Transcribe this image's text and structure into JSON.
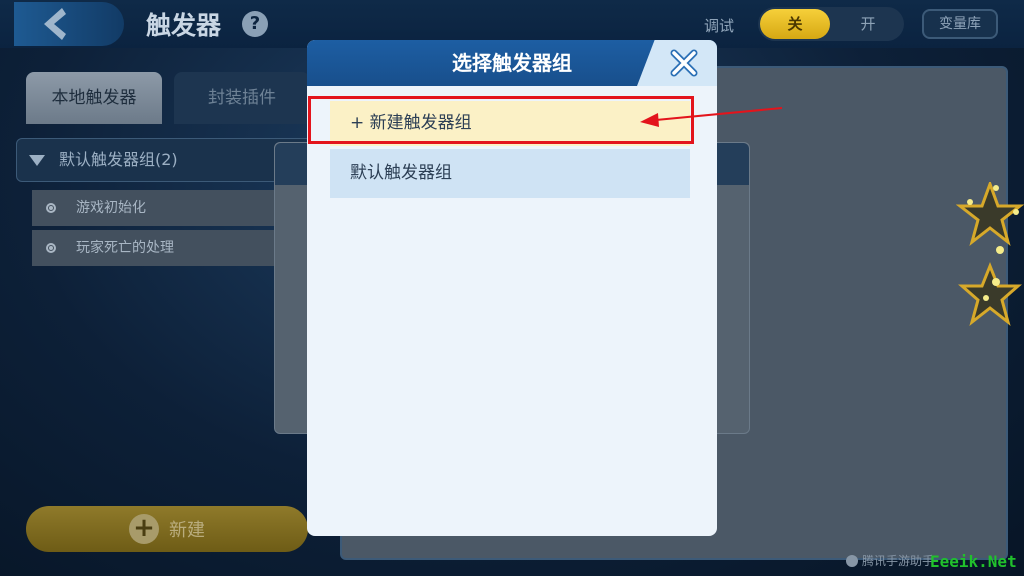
{
  "header": {
    "title": "触发器",
    "help": "?",
    "debug_label": "调试",
    "toggle_off": "关",
    "toggle_on": "开",
    "variables_button": "变量库"
  },
  "tabs": [
    {
      "label": "本地触发器"
    },
    {
      "label": "封装插件"
    }
  ],
  "left_panel": {
    "group_label": "默认触发器组(2)",
    "items": [
      {
        "label": "游戏初始化"
      },
      {
        "label": "玩家死亡的处理"
      }
    ],
    "new_button": "新建"
  },
  "modal": {
    "title": "选择触发器组",
    "options": [
      {
        "label": "+ 新建触发器组"
      },
      {
        "label": "默认触发器组"
      }
    ]
  },
  "footer": {
    "watermark_left": "腾讯手游助手",
    "watermark_right": "Eeeik.Net"
  },
  "colors": {
    "annotation_red": "#e3141c",
    "modal_header": "#1d5ea3",
    "toggle_active": "#f6d03a"
  }
}
